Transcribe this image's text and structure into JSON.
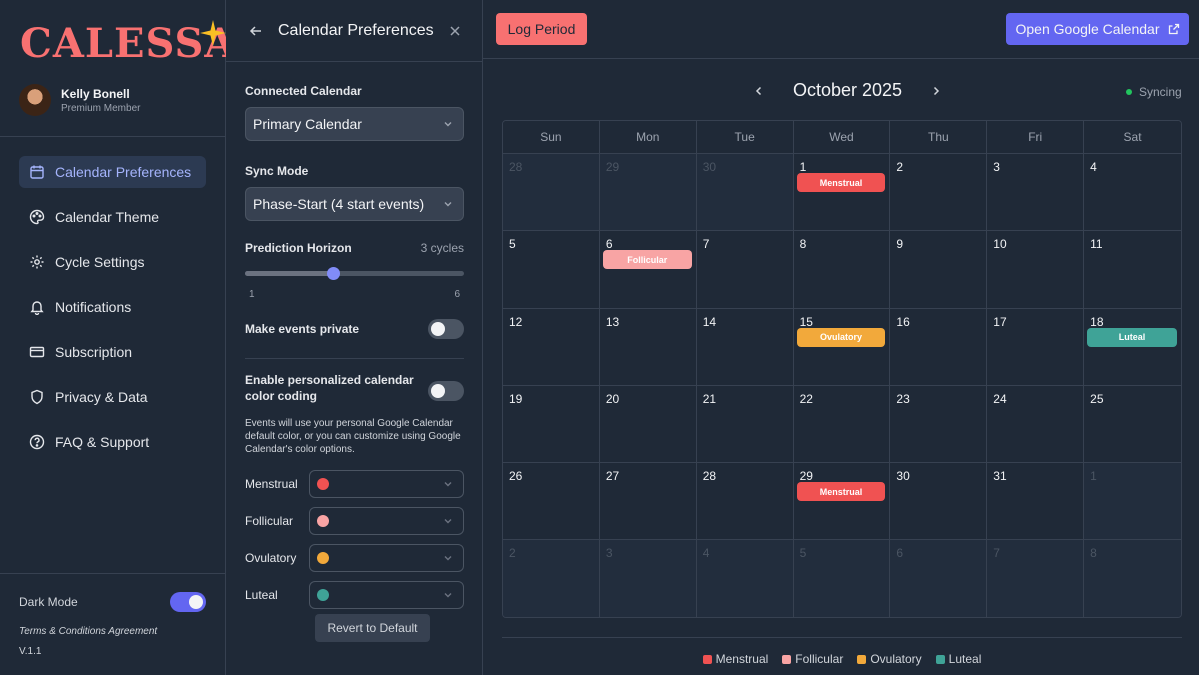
{
  "sidebar": {
    "logo_text": "CALESSA",
    "user_name": "Kelly Bonell",
    "user_status": "Premium Member",
    "nav": [
      {
        "label": "Calendar Preferences",
        "icon": "calendar-icon",
        "active": true
      },
      {
        "label": "Calendar Theme",
        "icon": "palette-icon",
        "active": false
      },
      {
        "label": "Cycle Settings",
        "icon": "gear-icon",
        "active": false
      },
      {
        "label": "Notifications",
        "icon": "bell-icon",
        "active": false
      },
      {
        "label": "Subscription",
        "icon": "credit-card-icon",
        "active": false
      },
      {
        "label": "Privacy & Data",
        "icon": "shield-icon",
        "active": false
      },
      {
        "label": "FAQ & Support",
        "icon": "help-circle-icon",
        "active": false
      }
    ],
    "dark_mode_label": "Dark Mode",
    "dark_mode_on": true,
    "terms": "Terms & Conditions Agreement",
    "version": "V.1.1"
  },
  "prefs": {
    "title": "Calendar Preferences",
    "connected_calendar_label": "Connected Calendar",
    "connected_calendar_value": "Primary Calendar",
    "sync_mode_label": "Sync Mode",
    "sync_mode_value": "Phase-Start (4 start events)",
    "horizon_label": "Prediction Horizon",
    "horizon_value": "3 cycles",
    "horizon_min": "1",
    "horizon_max": "6",
    "horizon_level": 0.4,
    "private_label": "Make events private",
    "private_on": false,
    "color_coding_label": "Enable personalized calendar color coding",
    "color_coding_on": false,
    "help_text": "Events will use your personal Google Calendar default color, or you can customize using Google Calendar's color options.",
    "phases": [
      {
        "label": "Menstrual",
        "color": "#f05252"
      },
      {
        "label": "Follicular",
        "color": "#f8a4a4"
      },
      {
        "label": "Ovulatory",
        "color": "#f2a93b"
      },
      {
        "label": "Luteal",
        "color": "#3fa397"
      }
    ],
    "revert_label": "Revert to Default"
  },
  "main": {
    "log_period": "Log Period",
    "open_gcal": "Open Google Calendar",
    "month": "October 2025",
    "sync_status": "Syncing",
    "weekdays": [
      "Sun",
      "Mon",
      "Tue",
      "Wed",
      "Thu",
      "Fri",
      "Sat"
    ],
    "days": [
      {
        "d": "28",
        "out": true
      },
      {
        "d": "29",
        "out": true
      },
      {
        "d": "30",
        "out": true
      },
      {
        "d": "1",
        "event": "Menstrual",
        "color": "#f05252"
      },
      {
        "d": "2"
      },
      {
        "d": "3"
      },
      {
        "d": "4"
      },
      {
        "d": "5"
      },
      {
        "d": "6",
        "event": "Follicular",
        "color": "#f8a4a4"
      },
      {
        "d": "7"
      },
      {
        "d": "8"
      },
      {
        "d": "9"
      },
      {
        "d": "10"
      },
      {
        "d": "11"
      },
      {
        "d": "12"
      },
      {
        "d": "13"
      },
      {
        "d": "14"
      },
      {
        "d": "15",
        "event": "Ovulatory",
        "color": "#f2a93b"
      },
      {
        "d": "16"
      },
      {
        "d": "17"
      },
      {
        "d": "18",
        "event": "Luteal",
        "color": "#3fa397"
      },
      {
        "d": "19"
      },
      {
        "d": "20"
      },
      {
        "d": "21"
      },
      {
        "d": "22"
      },
      {
        "d": "23"
      },
      {
        "d": "24"
      },
      {
        "d": "25"
      },
      {
        "d": "26"
      },
      {
        "d": "27"
      },
      {
        "d": "28"
      },
      {
        "d": "29",
        "event": "Menstrual",
        "color": "#f05252"
      },
      {
        "d": "30"
      },
      {
        "d": "31"
      },
      {
        "d": "1",
        "out": true
      },
      {
        "d": "2",
        "out": true
      },
      {
        "d": "3",
        "out": true
      },
      {
        "d": "4",
        "out": true
      },
      {
        "d": "5",
        "out": true
      },
      {
        "d": "6",
        "out": true
      },
      {
        "d": "7",
        "out": true
      },
      {
        "d": "8",
        "out": true
      }
    ],
    "legend": [
      {
        "label": "Menstrual",
        "color": "#f05252"
      },
      {
        "label": "Follicular",
        "color": "#f8a4a4"
      },
      {
        "label": "Ovulatory",
        "color": "#f2a93b"
      },
      {
        "label": "Luteal",
        "color": "#3fa397"
      }
    ]
  }
}
